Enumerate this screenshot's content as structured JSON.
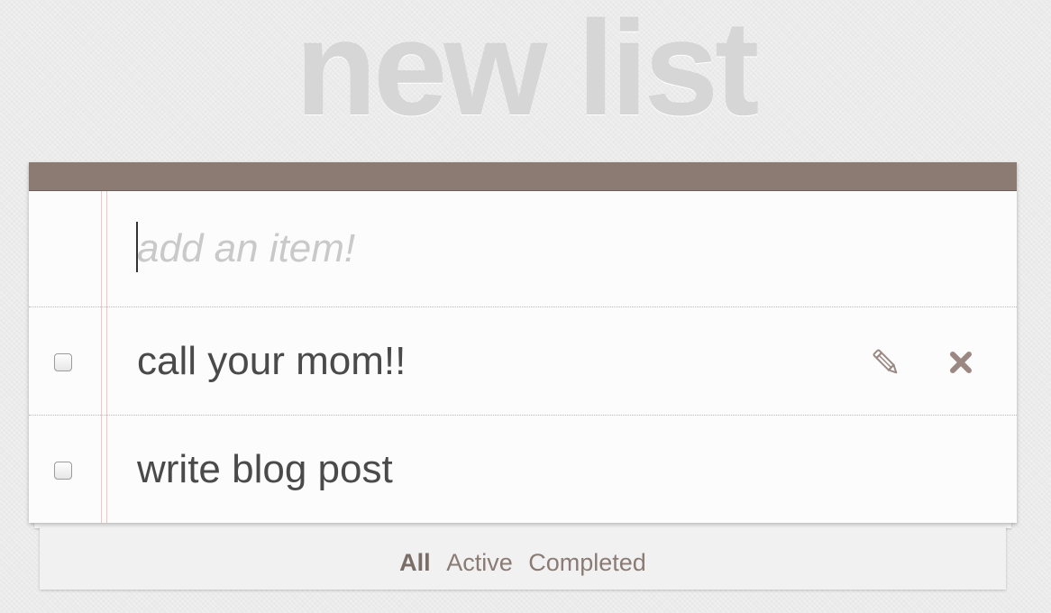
{
  "title": "new list",
  "new_item": {
    "placeholder": "add an item!",
    "value": ""
  },
  "todos": [
    {
      "text": "call your mom!!",
      "completed": false
    },
    {
      "text": "write blog post",
      "completed": false
    }
  ],
  "filters": {
    "all": "All",
    "active": "Active",
    "completed": "Completed",
    "selected": "All"
  },
  "colors": {
    "header_bar": "#8b7b73",
    "icon_color": "#9c8883",
    "margin_line": "#f3c4c4",
    "title_color": "#d6d6d6"
  },
  "icons": {
    "edit": "pencil-icon",
    "delete": "close-icon"
  }
}
